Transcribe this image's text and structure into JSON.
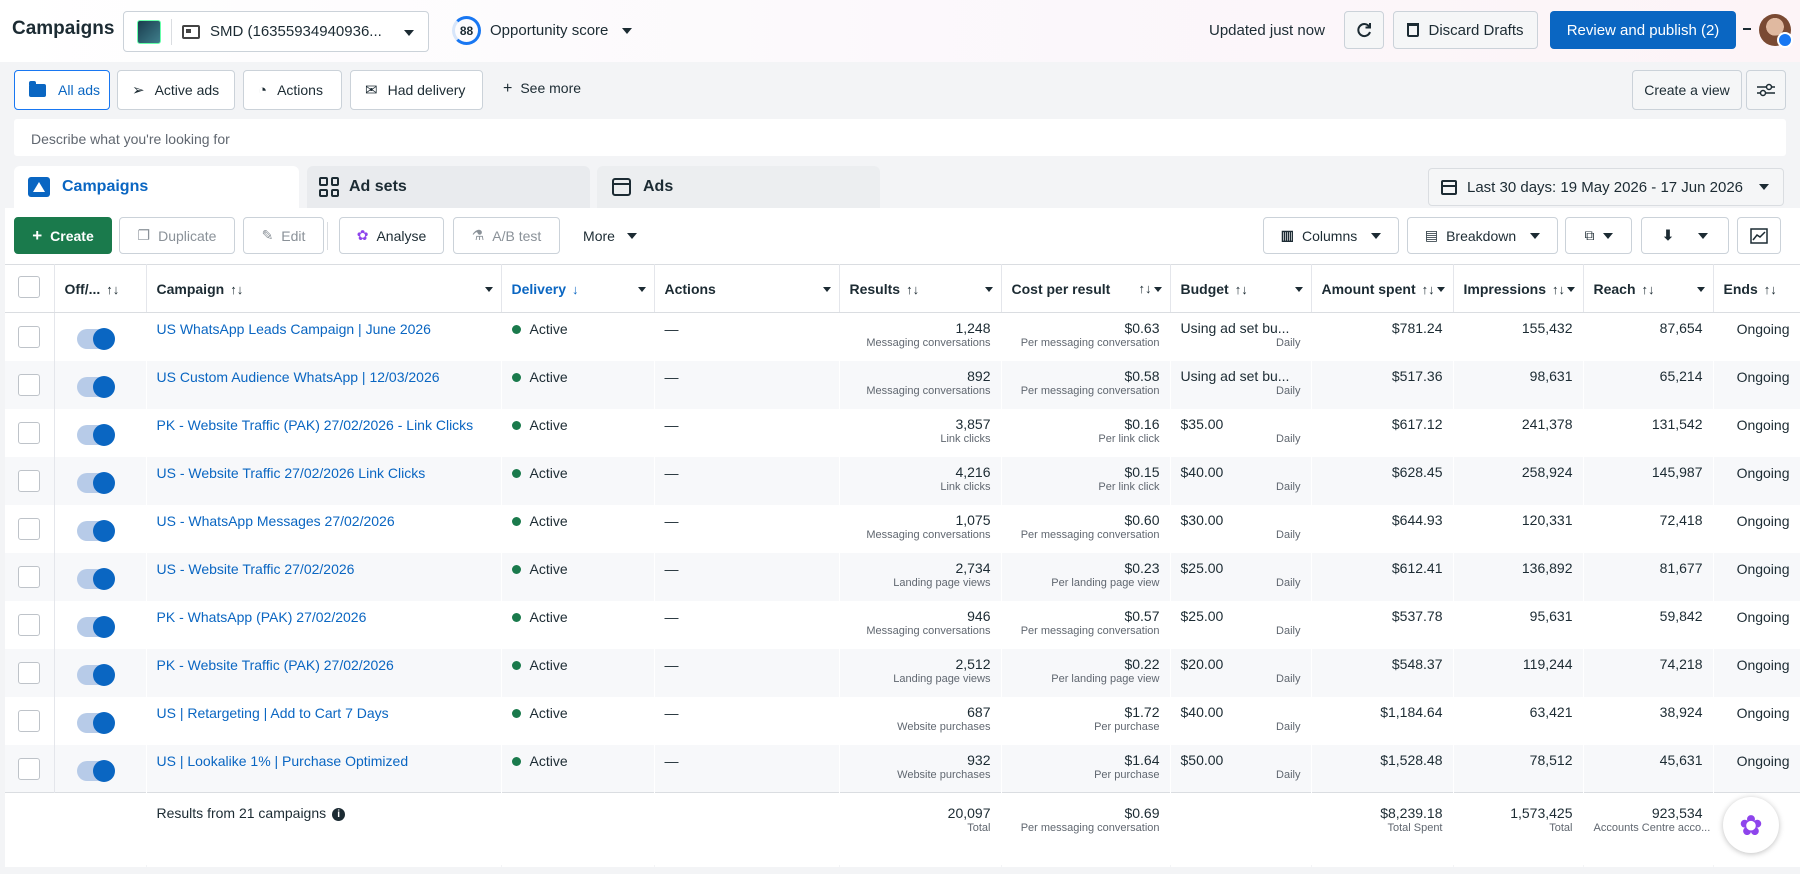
{
  "header": {
    "title": "Campaigns",
    "account": "SMD (16355934940936...",
    "opportunity_score_value": "88",
    "opportunity_score_label": "Opportunity score",
    "updated": "Updated just now",
    "discard": "Discard Drafts",
    "publish": "Review and publish (2)"
  },
  "filters": {
    "all_ads": "All ads",
    "active_ads": "Active ads",
    "actions": "Actions",
    "had_delivery": "Had delivery",
    "see_more": "See more",
    "create_view": "Create a view"
  },
  "search": {
    "placeholder": "Describe what you're looking for"
  },
  "tabs": {
    "campaigns": "Campaigns",
    "ad_sets": "Ad sets",
    "ads": "Ads"
  },
  "date_range": "Last 30 days: 19 May 2026 - 17 Jun 2026",
  "toolbar": {
    "create": "Create",
    "duplicate": "Duplicate",
    "edit": "Edit",
    "analyse": "Analyse",
    "ab_test": "A/B test",
    "more": "More",
    "columns": "Columns",
    "breakdown": "Breakdown"
  },
  "columns": {
    "offon": "Off/...",
    "campaign": "Campaign",
    "delivery": "Delivery",
    "actions": "Actions",
    "results": "Results",
    "cost": "Cost per result",
    "budget": "Budget",
    "amount": "Amount spent",
    "impressions": "Impressions",
    "reach": "Reach",
    "ends": "Ends"
  },
  "rows": [
    {
      "name": "US WhatsApp Leads Campaign | June 2026",
      "delivery": "Active",
      "actions": "—",
      "results": "1,248",
      "results_sub": "Messaging conversations",
      "cost": "$0.63",
      "cost_sub": "Per messaging conversation",
      "budget": "Using ad set bu...",
      "budget_sub": "Daily",
      "amount": "$781.24",
      "impressions": "155,432",
      "reach": "87,654",
      "ends": "Ongoing"
    },
    {
      "name": "US Custom Audience WhatsApp | 12/03/2026",
      "delivery": "Active",
      "actions": "—",
      "results": "892",
      "results_sub": "Messaging conversations",
      "cost": "$0.58",
      "cost_sub": "Per messaging conversation",
      "budget": "Using ad set bu...",
      "budget_sub": "Daily",
      "amount": "$517.36",
      "impressions": "98,631",
      "reach": "65,214",
      "ends": "Ongoing"
    },
    {
      "name": "PK - Website Traffic (PAK) 27/02/2026 - Link Clicks",
      "delivery": "Active",
      "actions": "—",
      "results": "3,857",
      "results_sub": "Link clicks",
      "cost": "$0.16",
      "cost_sub": "Per link click",
      "budget": "$35.00",
      "budget_sub": "Daily",
      "amount": "$617.12",
      "impressions": "241,378",
      "reach": "131,542",
      "ends": "Ongoing"
    },
    {
      "name": "US - Website Traffic 27/02/2026 Link Clicks",
      "delivery": "Active",
      "actions": "—",
      "results": "4,216",
      "results_sub": "Link clicks",
      "cost": "$0.15",
      "cost_sub": "Per link click",
      "budget": "$40.00",
      "budget_sub": "Daily",
      "amount": "$628.45",
      "impressions": "258,924",
      "reach": "145,987",
      "ends": "Ongoing"
    },
    {
      "name": "US - WhatsApp Messages 27/02/2026",
      "delivery": "Active",
      "actions": "—",
      "results": "1,075",
      "results_sub": "Messaging conversations",
      "cost": "$0.60",
      "cost_sub": "Per messaging conversation",
      "budget": "$30.00",
      "budget_sub": "Daily",
      "amount": "$644.93",
      "impressions": "120,331",
      "reach": "72,418",
      "ends": "Ongoing"
    },
    {
      "name": "US - Website Traffic 27/02/2026",
      "delivery": "Active",
      "actions": "—",
      "results": "2,734",
      "results_sub": "Landing page views",
      "cost": "$0.23",
      "cost_sub": "Per landing page view",
      "budget": "$25.00",
      "budget_sub": "Daily",
      "amount": "$612.41",
      "impressions": "136,892",
      "reach": "81,677",
      "ends": "Ongoing"
    },
    {
      "name": "PK - WhatsApp (PAK) 27/02/2026",
      "delivery": "Active",
      "actions": "—",
      "results": "946",
      "results_sub": "Messaging conversations",
      "cost": "$0.57",
      "cost_sub": "Per messaging conversation",
      "budget": "$25.00",
      "budget_sub": "Daily",
      "amount": "$537.78",
      "impressions": "95,631",
      "reach": "59,842",
      "ends": "Ongoing"
    },
    {
      "name": "PK - Website Traffic (PAK) 27/02/2026",
      "delivery": "Active",
      "actions": "—",
      "results": "2,512",
      "results_sub": "Landing page views",
      "cost": "$0.22",
      "cost_sub": "Per landing page view",
      "budget": "$20.00",
      "budget_sub": "Daily",
      "amount": "$548.37",
      "impressions": "119,244",
      "reach": "74,218",
      "ends": "Ongoing"
    },
    {
      "name": "US | Retargeting | Add to Cart 7 Days",
      "delivery": "Active",
      "actions": "—",
      "results": "687",
      "results_sub": "Website purchases",
      "cost": "$1.72",
      "cost_sub": "Per purchase",
      "budget": "$40.00",
      "budget_sub": "Daily",
      "amount": "$1,184.64",
      "impressions": "63,421",
      "reach": "38,924",
      "ends": "Ongoing"
    },
    {
      "name": "US | Lookalike 1% | Purchase Optimized",
      "delivery": "Active",
      "actions": "—",
      "results": "932",
      "results_sub": "Website purchases",
      "cost": "$1.64",
      "cost_sub": "Per purchase",
      "budget": "$50.00",
      "budget_sub": "Daily",
      "amount": "$1,528.48",
      "impressions": "78,512",
      "reach": "45,631",
      "ends": "Ongoing"
    }
  ],
  "footer": {
    "label": "Results from 21 campaigns",
    "results": "20,097",
    "results_sub": "Total",
    "cost": "$0.69",
    "cost_sub": "Per messaging conversation",
    "amount": "$8,239.18",
    "amount_sub": "Total Spent",
    "impressions": "1,573,425",
    "impressions_sub": "Total",
    "reach": "923,534",
    "reach_sub": "Accounts Centre acco..."
  }
}
